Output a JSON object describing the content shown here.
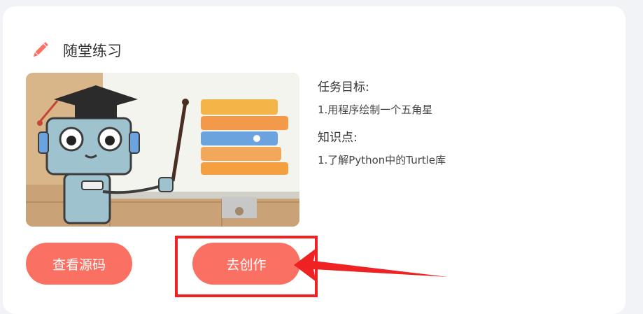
{
  "card": {
    "title": "随堂练习",
    "pencil_icon": "pencil-icon",
    "accent_color": "#fa7062"
  },
  "illustration": {
    "icon": "robot-teacher-illustration"
  },
  "task": {
    "goal_label": "任务目标:",
    "goal_item": "1.用程序绘制一个五角星",
    "knowledge_label": "知识点:",
    "knowledge_item": "1.了解Python中的Turtle库"
  },
  "buttons": {
    "view_source": "查看源码",
    "create": "去创作"
  },
  "annotation": {
    "box_color": "#ee2222",
    "arrow_color": "#ee2222"
  }
}
